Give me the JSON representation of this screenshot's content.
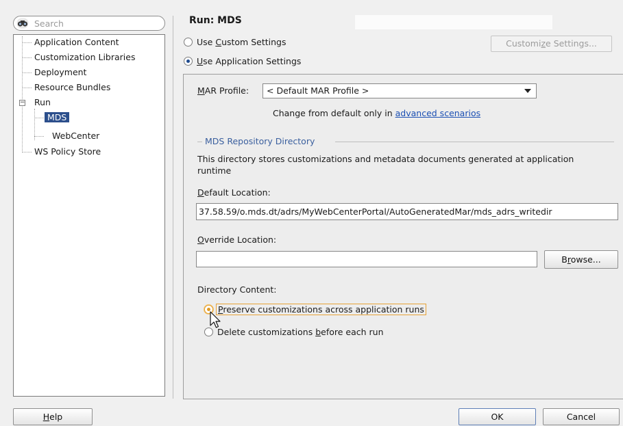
{
  "search": {
    "placeholder": "Search",
    "icon": "binoculars-icon"
  },
  "tree": {
    "items": [
      {
        "label": "Application Content"
      },
      {
        "label": "Customization Libraries"
      },
      {
        "label": "Deployment"
      },
      {
        "label": "Resource Bundles"
      },
      {
        "label": "Run",
        "expanded": true,
        "children": [
          {
            "label": "MDS",
            "selected": true
          },
          {
            "label": "WebCenter"
          }
        ]
      },
      {
        "label": "WS Policy Store"
      }
    ]
  },
  "page": {
    "title": "Run: MDS"
  },
  "settings_mode": {
    "custom": {
      "pre": "Use ",
      "mnemonic": "C",
      "post": "ustom Settings",
      "selected": false
    },
    "application": {
      "pre": "",
      "mnemonic": "U",
      "post": "se Application Settings",
      "selected": true
    },
    "customize_button": {
      "pre": "Customi",
      "mnemonic": "z",
      "post": "e Settings...",
      "enabled": false
    }
  },
  "mar_profile": {
    "label_mnemonic": "M",
    "label_rest": "AR Profile:",
    "value": "< Default MAR Profile >",
    "hint_prefix": "Change from default only in ",
    "hint_link": "advanced scenarios"
  },
  "mds_repo": {
    "section_title": "MDS Repository Directory",
    "description": "This directory stores customizations and metadata documents generated at application runtime",
    "default_location_mnemonic": "D",
    "default_location_rest": "efault Location:",
    "default_location_value": "37.58.59/o.mds.dt/adrs/MyWebCenterPortal/AutoGeneratedMar/mds_adrs_writedir",
    "override_location_mnemonic": "O",
    "override_location_rest": "verride Location:",
    "override_location_value": "",
    "browse_button": {
      "pre": "B",
      "mnemonic": "r",
      "post": "owse..."
    }
  },
  "directory_content": {
    "label": "Directory Content:",
    "preserve": {
      "mnemonic": "P",
      "rest": "reserve customizations across application runs",
      "selected": true
    },
    "delete": {
      "pre": "Delete customizations ",
      "mnemonic": "b",
      "post": "efore each run",
      "selected": false
    }
  },
  "footer": {
    "help": {
      "mnemonic": "H",
      "rest": "elp"
    },
    "ok": "OK",
    "cancel": "Cancel"
  },
  "colors": {
    "selection": "#2c4f8c",
    "focus": "#e7a135",
    "link": "#1b4fb3",
    "section": "#3a5f9e"
  }
}
